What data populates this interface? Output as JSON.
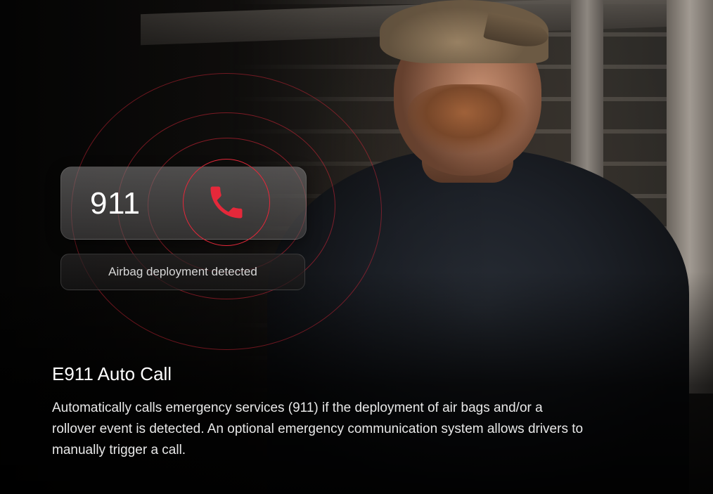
{
  "call_widget": {
    "number": "911",
    "icon": "phone-icon",
    "accent_color": "#e5283a",
    "status": "Airbag deployment detected"
  },
  "feature": {
    "title": "E911 Auto Call",
    "description": "Automatically calls emergency services (911) if the deployment of air bags and/or a rollover event is detected. An optional emergency communication system allows drivers to manually trigger a call."
  }
}
